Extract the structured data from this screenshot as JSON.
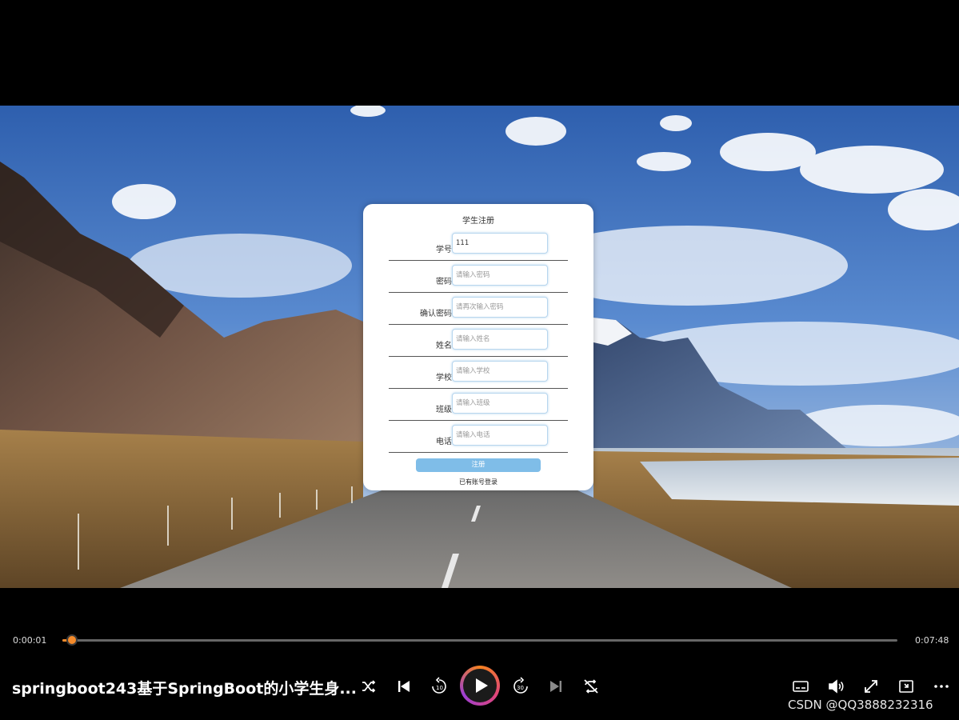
{
  "form": {
    "title": "学生注册",
    "fields": [
      {
        "label": "学号：",
        "value": "111",
        "placeholder": ""
      },
      {
        "label": "密码：",
        "value": "",
        "placeholder": "请输入密码"
      },
      {
        "label": "确认密码：",
        "value": "",
        "placeholder": "请再次输入密码"
      },
      {
        "label": "姓名：",
        "value": "",
        "placeholder": "请输入姓名"
      },
      {
        "label": "学校：",
        "value": "",
        "placeholder": "请输入学校"
      },
      {
        "label": "班级：",
        "value": "",
        "placeholder": "请输入班级"
      },
      {
        "label": "电话：",
        "value": "",
        "placeholder": "请输入电话"
      }
    ],
    "submit_label": "注册",
    "login_link": "已有账号登录"
  },
  "player": {
    "current_time": "0:00:01",
    "total_time": "0:07:48",
    "progress": 0.002,
    "title": "springboot243基于SpringBoot的小学生身...",
    "controls": [
      "shuffle-icon",
      "previous-icon",
      "rewind-10-icon",
      "play-icon",
      "forward-30-icon",
      "next-icon",
      "loop-icon",
      "subtitles-icon",
      "volume-icon",
      "fullscreen-icon",
      "mini-player-icon",
      "more-icon"
    ],
    "accent_color": "#f58a2a"
  },
  "watermark": "CSDN @QQ3888232316"
}
